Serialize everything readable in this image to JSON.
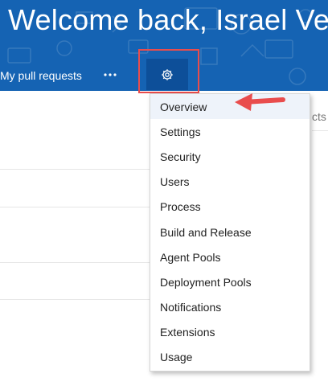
{
  "header": {
    "welcome_text": "Welcome back, Israel Vega",
    "nav_link": "My pull requests",
    "more_glyph": "•••",
    "gear_icon": "gear-icon",
    "background_color": "#1563b3",
    "gear_button_color": "#0d4f99"
  },
  "background": {
    "search_fragment": "cts"
  },
  "menu": {
    "items": [
      {
        "label": "Overview"
      },
      {
        "label": "Settings"
      },
      {
        "label": "Security"
      },
      {
        "label": "Users"
      },
      {
        "label": "Process"
      },
      {
        "label": "Build and Release"
      },
      {
        "label": "Agent Pools"
      },
      {
        "label": "Deployment Pools"
      },
      {
        "label": "Notifications"
      },
      {
        "label": "Extensions"
      },
      {
        "label": "Usage"
      }
    ]
  },
  "annotations": {
    "highlight_color": "#e94d4d",
    "arrow_icon": "arrow-left-icon"
  }
}
